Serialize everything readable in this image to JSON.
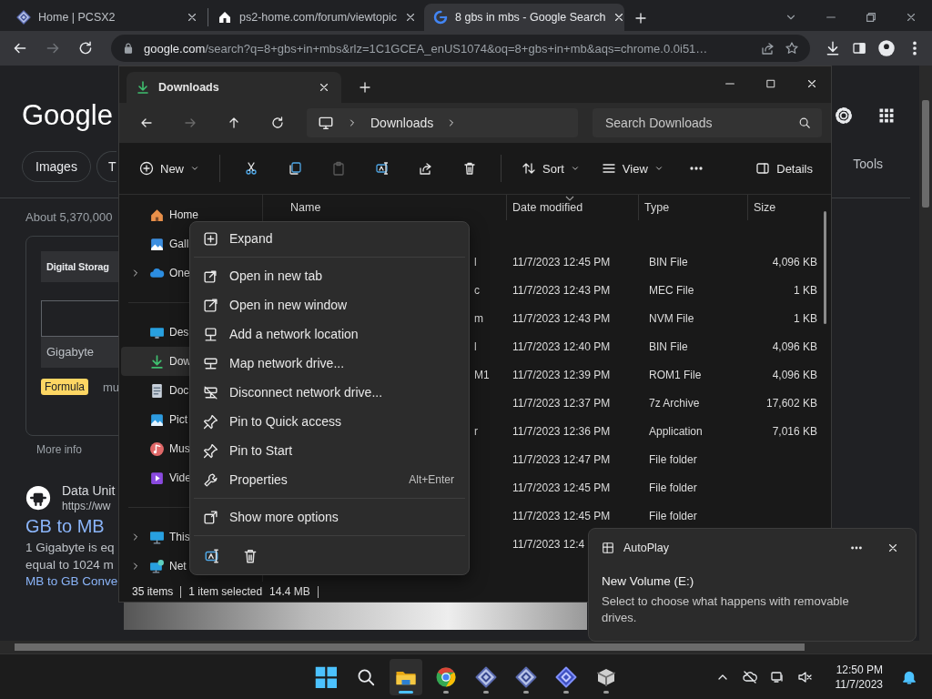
{
  "browser": {
    "tabs": [
      {
        "kind": "pcsx2",
        "title": "Home | PCSX2",
        "selected": false
      },
      {
        "kind": "house",
        "title": "ps2-home.com/forum/viewtopic",
        "selected": false
      },
      {
        "kind": "google",
        "title": "8 gbs in mbs - Google Search",
        "selected": true
      }
    ],
    "nav": [
      {
        "kind": "back",
        "disabled": false
      },
      {
        "kind": "forward",
        "disabled": true
      },
      {
        "kind": "reload",
        "disabled": false
      }
    ],
    "address": {
      "host": "google.com",
      "path": "/search?q=8+gbs+in+mbs&rlz=1C1GCEA_enUS1074&oq=8+gbs+in+mb&aqs=chrome.0.0i51…"
    }
  },
  "google": {
    "logo": "Google",
    "chips": [
      "Images",
      "T"
    ],
    "tools": "Tools",
    "results_count": "About 5,370,000",
    "card": {
      "title": "Digital Storag",
      "unit": "Gigabyte",
      "badge": "Formula",
      "formula": "mu",
      "more": "More info"
    },
    "result": {
      "site": "Data Unit",
      "url": "https://ww",
      "title": "GB to MB",
      "snippet": [
        "1 Gigabyte is eq",
        "equal to 1024 m"
      ],
      "link": "MB to GB Conve"
    }
  },
  "explorer": {
    "tab": "Downloads",
    "nav": [
      {
        "kind": "back",
        "disabled": false
      },
      {
        "kind": "forward",
        "disabled": true
      },
      {
        "kind": "up",
        "disabled": false
      },
      {
        "kind": "reload",
        "disabled": false
      }
    ],
    "breadcrumb": "Downloads",
    "search": {
      "placeholder": "Search Downloads"
    },
    "toolbar": [
      {
        "kind": "new",
        "label": "New",
        "disabled": false
      },
      {
        "kind": "cut",
        "disabled": false
      },
      {
        "kind": "copy",
        "disabled": false
      },
      {
        "kind": "paste",
        "disabled": true
      },
      {
        "kind": "rename",
        "disabled": false
      },
      {
        "kind": "share",
        "disabled": false
      },
      {
        "kind": "delete",
        "disabled": false
      },
      {
        "kind": "sort",
        "label": "Sort",
        "disabled": false
      },
      {
        "kind": "view",
        "label": "View",
        "disabled": false
      },
      {
        "kind": "more",
        "disabled": false
      },
      {
        "kind": "details",
        "label": "Details",
        "disabled": false
      }
    ],
    "sidebar": [
      [
        {
          "kind": "home",
          "label": "Home",
          "expandable": false,
          "selected": false
        },
        {
          "kind": "gallery",
          "label": "Gall",
          "expandable": false,
          "selected": false
        },
        {
          "kind": "cloud",
          "label": "One",
          "expandable": true,
          "selected": false
        }
      ],
      [
        {
          "kind": "desktop",
          "label": "Des",
          "expandable": false,
          "selected": false
        },
        {
          "kind": "downloads",
          "label": "Dow",
          "expandable": false,
          "selected": true
        },
        {
          "kind": "documents",
          "label": "Doc",
          "expandable": false,
          "selected": false
        },
        {
          "kind": "pictures",
          "label": "Pict",
          "expandable": false,
          "selected": false
        },
        {
          "kind": "music",
          "label": "Mus",
          "expandable": false,
          "selected": false
        },
        {
          "kind": "videos",
          "label": "Vide",
          "expandable": false,
          "selected": false
        }
      ],
      [
        {
          "kind": "pc",
          "label": "This",
          "expandable": true,
          "selected": false
        },
        {
          "kind": "network",
          "label": "Net",
          "expandable": true,
          "selected": false
        }
      ]
    ],
    "columns": [
      {
        "label": "Name",
        "sorted": false
      },
      {
        "label": "Date modified",
        "sorted": true
      },
      {
        "label": "Type",
        "sorted": false
      },
      {
        "label": "Size",
        "sorted": false
      }
    ],
    "rows": [
      {
        "name": "l",
        "date": "11/7/2023 12:45 PM",
        "type": "BIN File",
        "size": "4,096 KB"
      },
      {
        "name": "c",
        "date": "11/7/2023 12:43 PM",
        "type": "MEC File",
        "size": "1 KB"
      },
      {
        "name": "m",
        "date": "11/7/2023 12:43 PM",
        "type": "NVM File",
        "size": "1 KB"
      },
      {
        "name": "l",
        "date": "11/7/2023 12:40 PM",
        "type": "BIN File",
        "size": "4,096 KB"
      },
      {
        "name": "M1",
        "date": "11/7/2023 12:39 PM",
        "type": "ROM1 File",
        "size": "4,096 KB"
      },
      {
        "date": "11/7/2023 12:37 PM",
        "type": "7z Archive",
        "size": "17,602 KB"
      },
      {
        "name": "r",
        "date": "11/7/2023 12:36 PM",
        "type": "Application",
        "size": "7,016 KB"
      },
      {
        "date": "11/7/2023 12:47 PM",
        "type": "File folder"
      },
      {
        "date": "11/7/2023 12:45 PM",
        "type": "File folder"
      },
      {
        "date": "11/7/2023 12:45 PM",
        "type": "File folder"
      },
      {
        "date": "11/7/2023 12:4"
      }
    ],
    "status": {
      "count": "35 items",
      "selected": "1 item selected",
      "size": "14.4 MB"
    }
  },
  "context_menu": {
    "groups": [
      [
        {
          "kind": "expand",
          "label": "Expand"
        }
      ],
      [
        {
          "kind": "open-tab",
          "label": "Open in new tab"
        },
        {
          "kind": "open-window",
          "label": "Open in new window"
        },
        {
          "kind": "network-location",
          "label": "Add a network location"
        },
        {
          "kind": "map-drive",
          "label": "Map network drive..."
        },
        {
          "kind": "disconnect-drive",
          "label": "Disconnect network drive..."
        },
        {
          "kind": "pin",
          "label": "Pin to Quick access"
        },
        {
          "kind": "pin",
          "label": "Pin to Start"
        },
        {
          "kind": "properties",
          "label": "Properties",
          "shortcut": "Alt+Enter"
        }
      ],
      [
        {
          "kind": "more-options",
          "label": "Show more options"
        }
      ]
    ],
    "actions": [
      {
        "kind": "rename"
      },
      {
        "kind": "delete"
      }
    ]
  },
  "toast": {
    "app": "AutoPlay",
    "title": "New Volume (E:)",
    "body": "Select to choose what happens with removable drives."
  },
  "taskbar": {
    "apps": [
      {
        "kind": "start",
        "running": false,
        "active": false
      },
      {
        "kind": "search",
        "running": false,
        "active": false
      },
      {
        "kind": "explorer",
        "running": true,
        "active": true
      },
      {
        "kind": "chrome",
        "running": true,
        "active": false
      },
      {
        "kind": "pcsx2",
        "running": true,
        "active": false
      },
      {
        "kind": "pcsx2",
        "running": true,
        "active": false
      },
      {
        "kind": "pcsx2-blue",
        "running": true,
        "active": false
      },
      {
        "kind": "package",
        "running": true,
        "active": false
      }
    ],
    "time": "12:50 PM",
    "date": "11/7/2023"
  }
}
